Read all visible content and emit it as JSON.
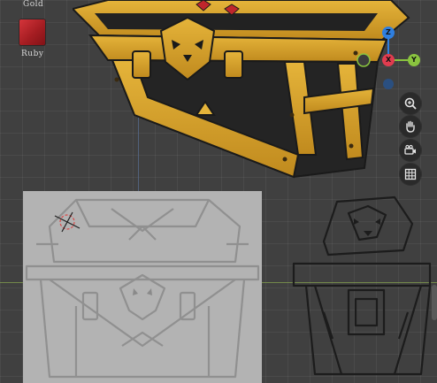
{
  "materials": {
    "gold_label": "Gold",
    "ruby_label": "Ruby",
    "ruby_color": "#c0262c"
  },
  "gizmo": {
    "z_label": "Z",
    "x_label": "X",
    "y_label": "Y",
    "z_color": "#2f7fe0",
    "x_color": "#e03c4f",
    "y_color": "#8ac43f"
  },
  "navigation": {
    "zoom_icon": "zoom-in-icon",
    "pan_icon": "hand-icon",
    "camera_icon": "camera-icon",
    "grid_icon": "grid-icon"
  },
  "colors": {
    "viewport_bg": "#404040",
    "chest_gold": "#d4a12a",
    "chest_dark": "#1e1e1e",
    "reference_bg": "#b3b3b3"
  }
}
